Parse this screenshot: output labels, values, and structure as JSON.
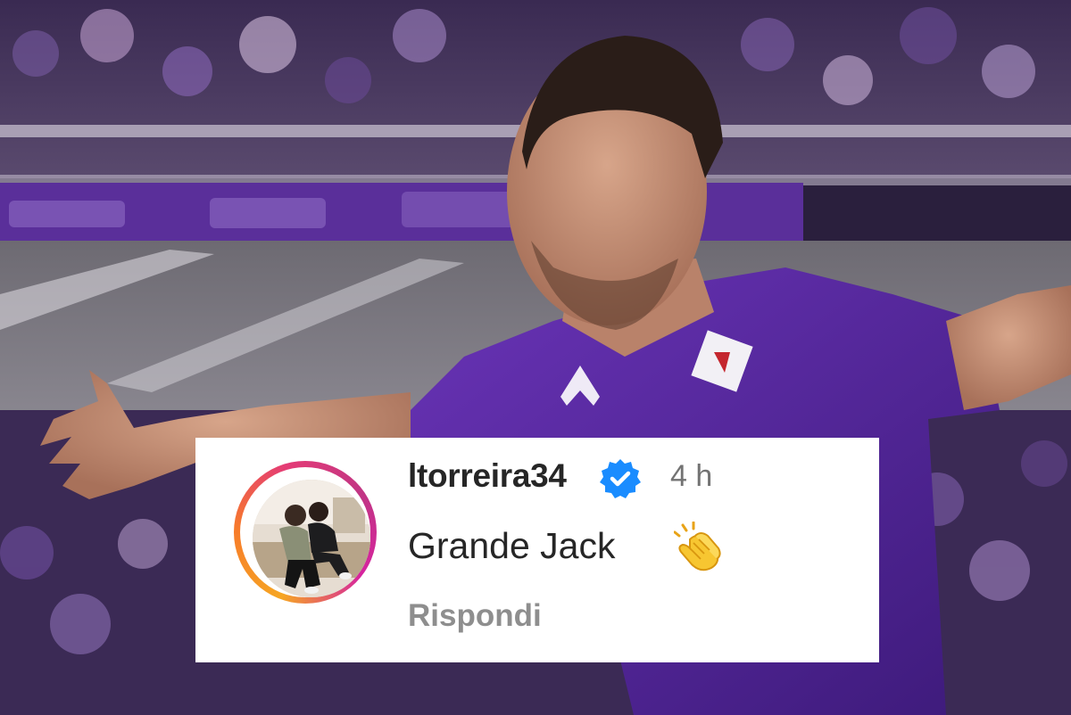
{
  "photo": {
    "description_icon": "celebrating-player-photo",
    "jersey_color": "#5b2a9e",
    "stand_color": "#4a2f7a"
  },
  "comment": {
    "username": "ltorreira34",
    "verified_icon": "verified-badge-icon",
    "time": "4 h",
    "text": "Grande Jack",
    "emoji_icon": "clapping-hands-icon",
    "reply_label": "Rispondi",
    "ring_colors": [
      "#f6a623",
      "#e43b76",
      "#c13584"
    ],
    "verified_color": "#1a8cff"
  }
}
